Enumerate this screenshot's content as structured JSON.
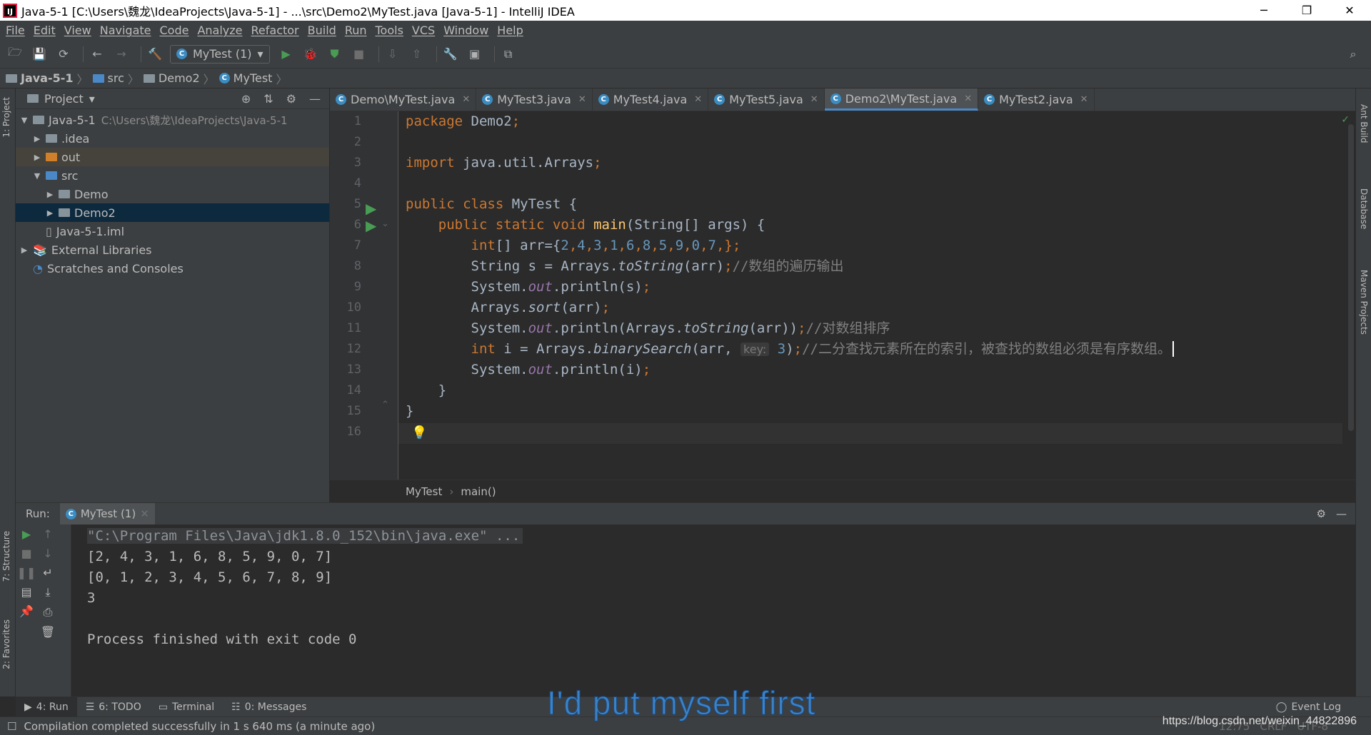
{
  "window": {
    "title": "Java-5-1 [C:\\Users\\魏龙\\IdeaProjects\\Java-5-1] - ...\\src\\Demo2\\MyTest.java [Java-5-1] - IntelliJ IDEA",
    "minimize": "─",
    "restore": "❐",
    "close": "✕"
  },
  "menu": [
    "File",
    "Edit",
    "View",
    "Navigate",
    "Code",
    "Analyze",
    "Refactor",
    "Build",
    "Run",
    "Tools",
    "VCS",
    "Window",
    "Help"
  ],
  "toolbar": {
    "run_config": "MyTest (1)"
  },
  "breadcrumb": [
    "Java-5-1",
    "src",
    "Demo2",
    "MyTest"
  ],
  "project": {
    "title": "Project",
    "tree": [
      {
        "label": "Java-5-1",
        "path": "C:\\Users\\魏龙\\IdeaProjects\\Java-5-1",
        "indent": 0,
        "arrow": "▼",
        "icon": "module"
      },
      {
        "label": ".idea",
        "indent": 1,
        "arrow": "▶",
        "icon": "folder"
      },
      {
        "label": "out",
        "indent": 1,
        "arrow": "▶",
        "icon": "folder-orange"
      },
      {
        "label": "src",
        "indent": 1,
        "arrow": "▼",
        "icon": "folder-blue"
      },
      {
        "label": "Demo",
        "indent": 2,
        "arrow": "▶",
        "icon": "package"
      },
      {
        "label": "Demo2",
        "indent": 2,
        "arrow": "▶",
        "icon": "package"
      },
      {
        "label": "Java-5-1.iml",
        "indent": 1,
        "arrow": "",
        "icon": "file"
      },
      {
        "label": "External Libraries",
        "indent": 0,
        "arrow": "▶",
        "icon": "library"
      },
      {
        "label": "Scratches and Consoles",
        "indent": 0,
        "arrow": "",
        "icon": "scratch"
      }
    ]
  },
  "tabs": [
    {
      "label": "Demo\\MyTest.java",
      "active": false
    },
    {
      "label": "MyTest3.java",
      "active": false
    },
    {
      "label": "MyTest4.java",
      "active": false
    },
    {
      "label": "MyTest5.java",
      "active": false
    },
    {
      "label": "Demo2\\MyTest.java",
      "active": true
    },
    {
      "label": "MyTest2.java",
      "active": false
    }
  ],
  "editor": {
    "line_numbers": [
      "1",
      "2",
      "3",
      "4",
      "5",
      "6",
      "7",
      "8",
      "9",
      "10",
      "11",
      "12",
      "13",
      "14",
      "15",
      "16"
    ],
    "code": {
      "l1a": "package",
      "l1b": " Demo2",
      "l3a": "import",
      "l3b": " java.util.Arrays",
      "l5a": "public class",
      "l5b": " MyTest {",
      "l6a": "public static void ",
      "l6b": "main",
      "l6c": "(String[] args) {",
      "l7a": "int",
      "l7b": "[] arr={",
      "l7nums": [
        "2",
        "4",
        "3",
        "1",
        "6",
        "8",
        "5",
        "9",
        "0",
        "7"
      ],
      "l7c": "};",
      "l8a": "String s = Arrays.",
      "l8b": "toString",
      "l8c": "(arr)",
      "l8d": "//数组的遍历输出",
      "l9a": "System.",
      "l9b": "out",
      "l9c": ".println(s)",
      "l10a": "Arrays.",
      "l10b": "sort",
      "l10c": "(arr)",
      "l11a": "System.",
      "l11b": "out",
      "l11c": ".println(Arrays.",
      "l11d": "toString",
      "l11e": "(arr))",
      "l11f": "//对数组排序",
      "l12a": "int",
      "l12b": " i = Arrays.",
      "l12c": "binarySearch",
      "l12d": "(arr, ",
      "l12hint": "key:",
      "l12num": "3",
      "l12e": ")",
      "l12f": "//二分查找元素所在的索引，被查找的数组必须是有序数组。",
      "l13a": "System.",
      "l13b": "out",
      "l13c": ".println(i)",
      "l14": "}",
      "l15": "}"
    },
    "breadcrumb": [
      "MyTest",
      "main()"
    ]
  },
  "run": {
    "label": "Run:",
    "tab": "MyTest (1)",
    "output": [
      "\"C:\\Program Files\\Java\\jdk1.8.0_152\\bin\\java.exe\" ...",
      "[2, 4, 3, 1, 6, 8, 5, 9, 0, 7]",
      "[0, 1, 2, 3, 4, 5, 6, 7, 8, 9]",
      "3",
      "",
      "Process finished with exit code 0"
    ]
  },
  "side_tabs": {
    "left": [
      "1: Project",
      "7: Structure",
      "2: Favorites"
    ],
    "right": [
      "Ant Build",
      "Database",
      "Maven Projects"
    ]
  },
  "bottom_tabs": [
    "4: Run",
    "6: TODO",
    "Terminal",
    "0: Messages"
  ],
  "event_log": "Event Log",
  "status": {
    "message": "Compilation completed successfully in 1 s 640 ms (a minute ago)",
    "position": "12:75",
    "line_sep": "CRLF",
    "encoding": "UTF-8"
  },
  "overlay": {
    "subtitle": "I'd put myself first",
    "watermark": "https://blog.csdn.net/weixin_44822896"
  }
}
